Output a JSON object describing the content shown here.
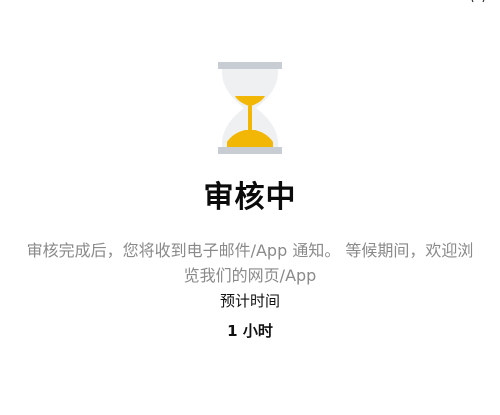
{
  "review": {
    "title": "审核中",
    "message": "审核完成后，您将收到电子邮件/App 通知。 等候期间，欢迎浏览我们的网页/App",
    "eta_label": "预计时间",
    "eta_value": "1 小时",
    "icon": "hourglass-icon"
  },
  "colors": {
    "accent": "#F2B705",
    "frame": "#C8CDD3",
    "glass": "#EEF0F2",
    "muted_text": "#8A8A8A"
  }
}
